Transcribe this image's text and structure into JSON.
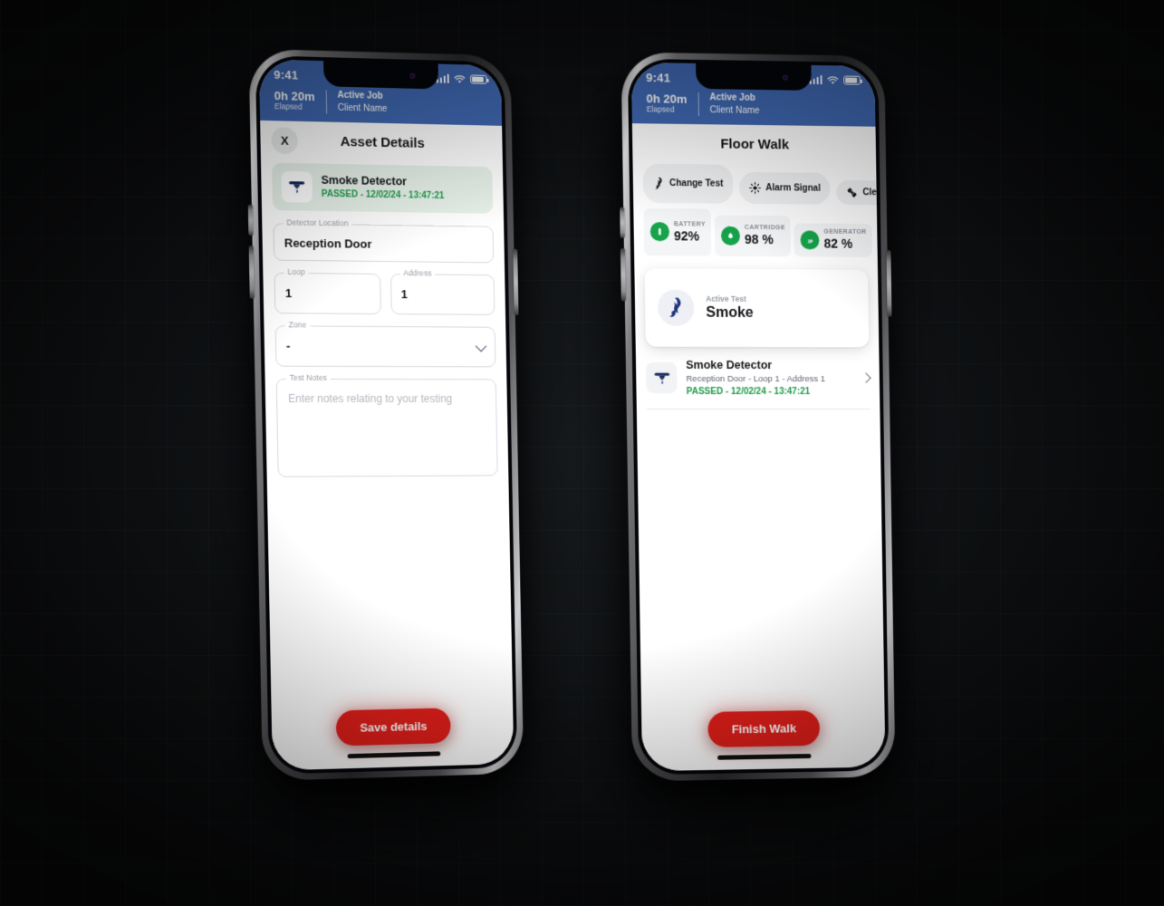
{
  "statusbar": {
    "time": "9:41",
    "signal_icon": "signal-bars-icon",
    "wifi_icon": "wifi-icon",
    "battery_icon": "battery-icon"
  },
  "job_header": {
    "elapsed_value": "0h 20m",
    "elapsed_label": "Elapsed",
    "job_label": "Active Job",
    "client_name": "Client Name",
    "bg_color": "#4069b3"
  },
  "screen_left": {
    "title": "Asset Details",
    "close_label": "X",
    "asset_banner": {
      "icon": "smoke-detector-icon",
      "name": "Smoke Detector",
      "status": "PASSED - 12/02/24 - 13:47:21",
      "status_color": "#1f9b4a",
      "bg_color": "#e7f2ea"
    },
    "fields": [
      {
        "label": "Detector Location",
        "value": "Reception Door",
        "placeholder": "",
        "type": "text"
      },
      {
        "label": "Loop",
        "value": "1",
        "placeholder": "",
        "type": "text"
      },
      {
        "label": "Address",
        "value": "1",
        "placeholder": "",
        "type": "text"
      },
      {
        "label": "Zone",
        "value": "-",
        "placeholder": "",
        "type": "select"
      },
      {
        "label": "Test Notes",
        "value": "",
        "placeholder": "Enter notes relating to your testing",
        "type": "textarea"
      }
    ],
    "cta": {
      "label": "Save details",
      "color": "#e01f1a"
    }
  },
  "screen_right": {
    "title": "Floor Walk",
    "chips": [
      {
        "label": "Change Test",
        "icon": "smoke-flame-icon"
      },
      {
        "label": "Alarm Signal",
        "icon": "alarm-burst-icon"
      },
      {
        "label": "Clearing",
        "icon": "fan-icon"
      }
    ],
    "metrics": [
      {
        "label": "BATTERY",
        "value": "92%",
        "icon": "battery-status-icon",
        "color": "#16a34a"
      },
      {
        "label": "CARTRIDGE",
        "value": "98 %",
        "icon": "droplet-icon",
        "color": "#16a34a"
      },
      {
        "label": "GENERATOR",
        "value": "82 %",
        "icon": "generator-icon",
        "color": "#16a34a"
      }
    ],
    "active_test": {
      "sub_label": "Active Test",
      "title": "Smoke",
      "icon": "smoke-flame-icon"
    },
    "assets": [
      {
        "icon": "smoke-detector-icon",
        "name": "Smoke Detector",
        "meta": "Reception Door  -  Loop 1 - Address 1",
        "status": "PASSED - 12/02/24 - 13:47:21",
        "chevron": "chevron-right-icon"
      }
    ],
    "cta": {
      "label": "Finish Walk",
      "color": "#e01f1a"
    }
  }
}
